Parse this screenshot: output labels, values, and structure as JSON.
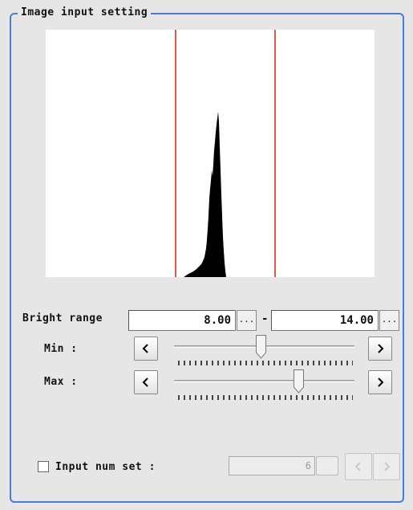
{
  "group": {
    "title": "Image input setting"
  },
  "bright_range": {
    "label": "Bright range",
    "min_value": "8.00",
    "max_value": "14.00",
    "separator": "-",
    "dots": "..."
  },
  "min_slider": {
    "label": "Min :",
    "level": 0.48
  },
  "max_slider": {
    "label": "Max :",
    "level": 0.69
  },
  "input_num": {
    "label": "Input num set :",
    "value": "6",
    "checked": false
  },
  "colors": {
    "border": "#4a7bd6",
    "marker": "#e4574f",
    "histogram": "#000000"
  },
  "icons": {
    "left": "chevron-left-icon",
    "right": "chevron-right-icon"
  }
}
